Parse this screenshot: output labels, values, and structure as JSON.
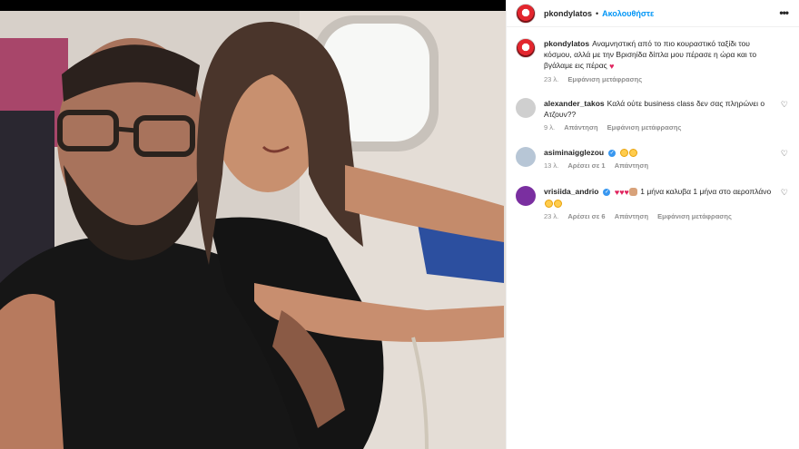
{
  "post": {
    "username": "pkondylatos",
    "separator": "•",
    "follow_label": "Ακολουθήστε",
    "more_label": "•••",
    "caption": "Αναμνηστική από το πιο κουραστικό ταξίδι του κόσμου, αλλά με την Βρισηίδα δίπλα μου πέρασε η ώρα και το βγάλαμε εις πέρας",
    "caption_time": "23 λ.",
    "caption_translate": "Εμφάνιση μετάφρασης"
  },
  "comments": [
    {
      "username": "alexander_takos",
      "text": "Καλά ούτε business class δεν σας πληρώνει ο Ατζουν??",
      "time": "9 λ.",
      "reply": "Απάντηση",
      "translate": "Εμφάνιση μετάφρασης",
      "avatar_color": "#cfcfcf"
    },
    {
      "username": "asiminaigglezou",
      "verified": true,
      "text": "",
      "emoji": [
        "heart-eyes-face",
        "heart-eyes-face"
      ],
      "time": "13 λ.",
      "likes": "Αρέσει σε 1",
      "reply": "Απάντηση",
      "avatar_color": "#b7c6d6"
    },
    {
      "username": "vrisiida_andrio",
      "verified": true,
      "text": "1 μήνα καλυβα 1 μήνα στο αεροπλάνο",
      "emoji_before": [
        "red-heart",
        "red-heart",
        "red-heart",
        "flexed-arm"
      ],
      "emoji_after": [
        "grinning-face",
        "grinning-face"
      ],
      "time": "23 λ.",
      "likes": "Αρέσει σε 6",
      "reply": "Απάντηση",
      "translate": "Εμφάνιση μετάφρασης",
      "avatar_color": "#7a2fa0"
    }
  ],
  "icons": {
    "like": "heart-outline-icon",
    "verified": "verified-badge-icon"
  },
  "colors": {
    "accent": "#0095f6",
    "muted": "#8e8e8e",
    "text": "#262626"
  }
}
